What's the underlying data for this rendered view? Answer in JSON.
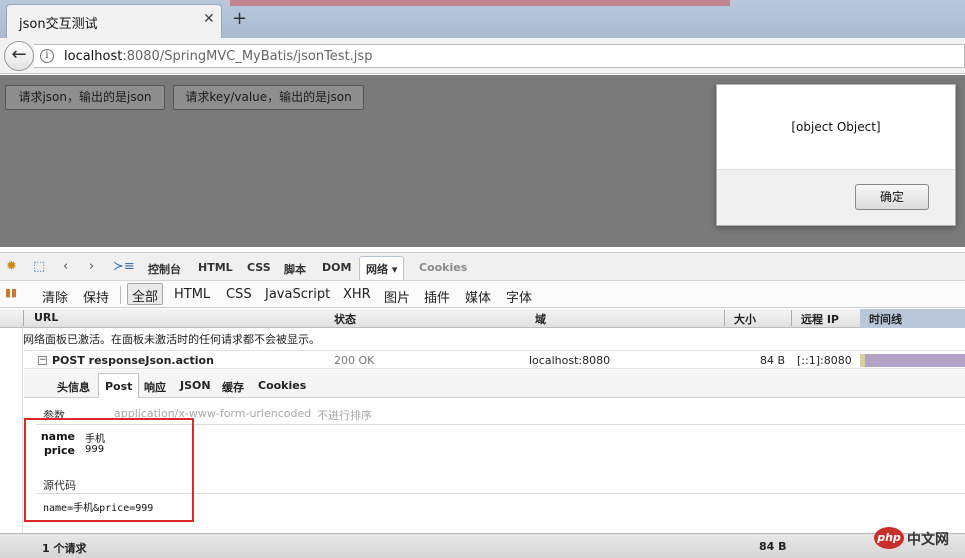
{
  "browser": {
    "tab_title": "json交互测试",
    "tab_close": "✕",
    "new_tab": "+",
    "url_host": "localhost",
    "url_rest": ":8080/SpringMVC_MyBatis/jsonTest.jsp"
  },
  "page": {
    "button_json": "请求json，输出的是json",
    "button_keyvalue": "请求key/value，输出的是json"
  },
  "alert": {
    "message": "[object Object]",
    "ok_label": "确定"
  },
  "firebug": {
    "tabs": [
      "控制台",
      "HTML",
      "CSS",
      "脚本",
      "DOM",
      "网络",
      "Cookies"
    ],
    "selected_tab": "网络",
    "filters": {
      "clear": "清除",
      "persist": "保持",
      "all": "全部",
      "html": "HTML",
      "css": "CSS",
      "js": "JavaScript",
      "xhr": "XHR",
      "images": "图片",
      "plugins": "插件",
      "media": "媒体",
      "fonts": "字体"
    },
    "columns": {
      "url": "URL",
      "status": "状态",
      "domain": "域",
      "size": "大小",
      "remote_ip": "远程 IP",
      "timeline": "时间线"
    },
    "notice": "网络面板已激活。在面板未激活时的任何请求都不会被显示。",
    "request": {
      "method_url": "POST responseJson.action",
      "status": "200 OK",
      "domain": "localhost:8080",
      "size": "84 B",
      "ip": "[::1]:8080"
    },
    "detail_tabs": [
      "头信息",
      "Post",
      "响应",
      "JSON",
      "缓存",
      "Cookies"
    ],
    "selected_detail_tab": "Post",
    "post": {
      "params_title": "参数",
      "content_type": "application/x-www-form-urlencoded",
      "sort_hint": "不进行排序",
      "params": [
        {
          "key": "name",
          "value": "手机"
        },
        {
          "key": "price",
          "value": "999"
        }
      ],
      "source_title": "源代码",
      "source": "name=手机&price=999"
    },
    "status": {
      "count": "1 个请求",
      "total_size": "84 B"
    }
  },
  "watermark": {
    "badge": "php",
    "text": "中文网"
  },
  "colors": {
    "highlight_border": "#e0282a",
    "page_dim": "#7a7a7a",
    "timeline_bar": "#b3a2c8"
  }
}
